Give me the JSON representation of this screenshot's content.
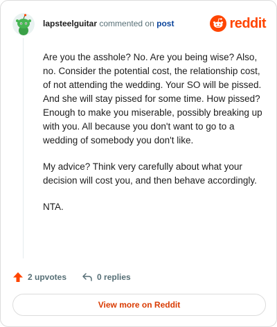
{
  "header": {
    "username": "lapsteelguitar",
    "action": "commented on",
    "post_link": "post",
    "logo_text": "reddit",
    "brand_color": "#ff4500"
  },
  "comment": {
    "paragraphs": [
      "Are you the asshole? No. Are you being wise? Also, no. Consider the potential cost, the relationship cost, of not attending the wedding. Your SO will be pissed. And she will stay pissed for some time. How pissed? Enough to make you miserable, possibly breaking up with you. All because you don't want to go to a wedding of somebody you don't like.",
      "My advice? Think very carefully about what your decision will cost you, and then behave accordingly.",
      "NTA."
    ]
  },
  "actions": {
    "upvotes": "2 upvotes",
    "replies": "0 replies",
    "upvote_icon": "upvote-arrow-icon",
    "reply_icon": "reply-arrow-icon"
  },
  "footer": {
    "view_more": "View more on Reddit"
  }
}
